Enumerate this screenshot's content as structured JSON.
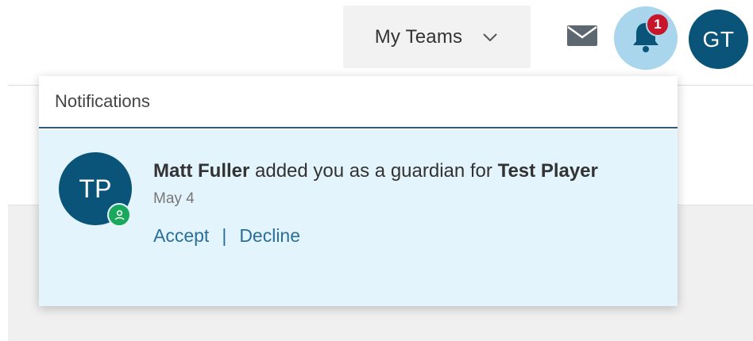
{
  "header": {
    "team_dropdown_label": "My Teams",
    "notification_count": "1",
    "user_initials": "GT",
    "icons": {
      "dropdown": "chevron-down-icon",
      "messages": "envelope-icon",
      "notifications": "bell-icon"
    }
  },
  "notifications": {
    "title": "Notifications",
    "items": [
      {
        "avatar_initials": "TP",
        "avatar_badge_icon": "user-icon",
        "actor": "Matt Fuller",
        "message": " added you as a guardian for ",
        "subject": "Test Player",
        "date": "May 4",
        "accept_label": "Accept",
        "separator": "|",
        "decline_label": "Decline"
      }
    ]
  },
  "colors": {
    "brand_navy": "#0b5479",
    "bell_highlight": "#a9d6ec",
    "badge_red": "#c7162b",
    "badge_green": "#1aa85d",
    "notification_bg": "#e3f4fc",
    "link_blue": "#2a6f98"
  }
}
